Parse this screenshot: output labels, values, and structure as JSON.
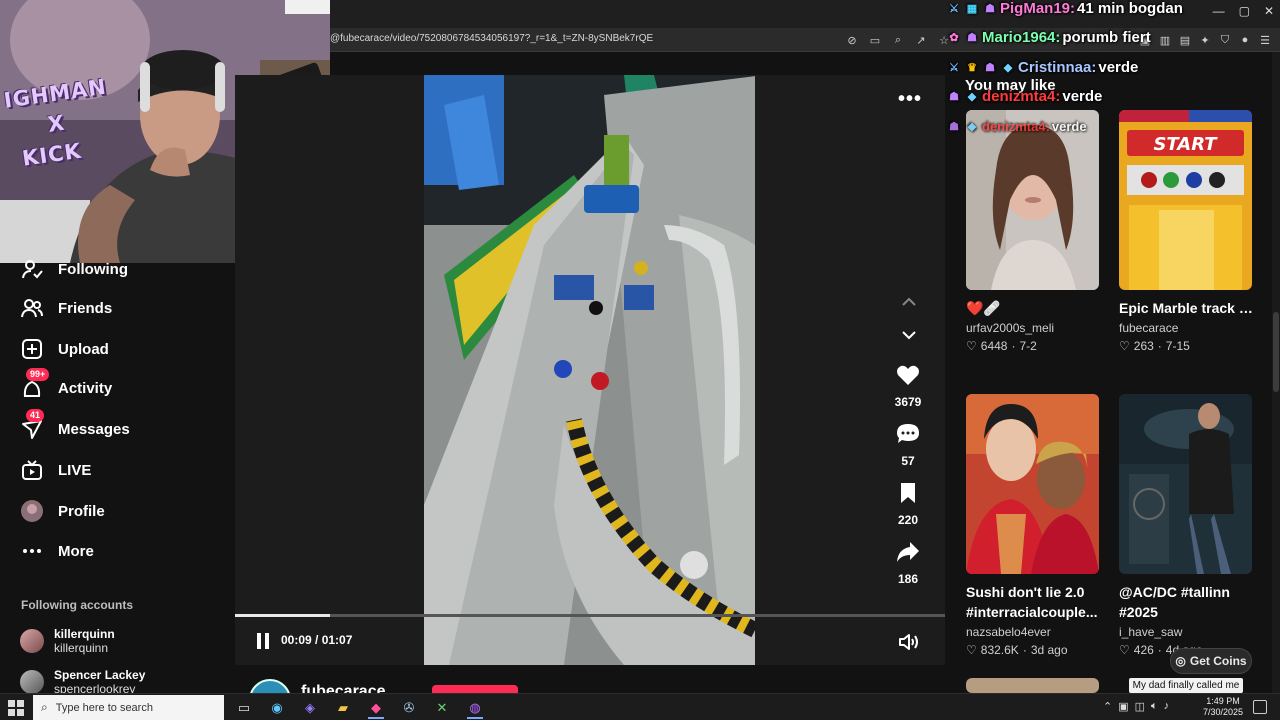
{
  "browser": {
    "url": "@fubecarace/video/7520806784534056197?_r=1&_t=ZN-8ySNBek7rQE",
    "window_controls": [
      "—",
      "▢",
      "✕"
    ]
  },
  "webcam": {
    "brand_line1": "IGHMAN",
    "brand_line2": "X",
    "brand_line3": "KICK"
  },
  "sidebar": {
    "items": [
      {
        "label": "Following",
        "icon": "following-icon"
      },
      {
        "label": "Friends",
        "icon": "friends-icon"
      },
      {
        "label": "Upload",
        "icon": "upload-icon"
      },
      {
        "label": "Activity",
        "icon": "activity-icon",
        "badge": "99+"
      },
      {
        "label": "Messages",
        "icon": "messages-icon",
        "badge": "41"
      },
      {
        "label": "LIVE",
        "icon": "live-icon"
      },
      {
        "label": "Profile",
        "icon": "profile-avatar"
      },
      {
        "label": "More",
        "icon": "more-icon"
      }
    ],
    "following_title": "Following accounts",
    "accounts": [
      {
        "name": "killerquinn",
        "handle": "killerquinn"
      },
      {
        "name": "Spencer Lackey",
        "handle": "spencerlookrey"
      }
    ]
  },
  "video": {
    "likes": "3679",
    "comments": "57",
    "saves": "220",
    "shares": "186",
    "time": "00:09 / 01:07",
    "progress": 0.134,
    "author": "fubecarace"
  },
  "recommended": {
    "title": "You may like",
    "cards": [
      {
        "title": "❤️🩹",
        "user": "urfav2000s_meli",
        "likes": "6448",
        "date": "7-2"
      },
      {
        "title": "Epic Marble track #MarbleRace...",
        "user": "fubecarace",
        "likes": "263",
        "date": "7-15"
      },
      {
        "title": "Sushi don't lie 2.0 #interracialcouple...",
        "user": "nazsabelo4ever",
        "likes": "832.6K",
        "date": "3d ago"
      },
      {
        "title": "@AC/DC #tallinn #2025",
        "user": "i_have_saw",
        "likes": "426",
        "date": "4d ago"
      }
    ],
    "get_coins": "Get Coins",
    "tooltip": "My dad finally called me"
  },
  "chat": [
    {
      "user": "PigMan19:",
      "msg": "41 min bogdan",
      "color": "#ff7ad9"
    },
    {
      "user": "Mario1964:",
      "msg": "porumb fiert",
      "color": "#7dffb0"
    },
    {
      "user": "Cristinnaa:",
      "msg": "verde",
      "color": "#a9c7ff"
    },
    {
      "user": "denizmta4:",
      "msg": "verde",
      "color": "#ff3b3b"
    },
    {
      "user": "denizmta4:",
      "msg": "verde",
      "color": "#ff3b3b"
    }
  ],
  "taskbar": {
    "search_placeholder": "Type here to search",
    "time": "1:49 PM",
    "date": "7/30/2025"
  },
  "colors": {
    "accent": "#fe2c55",
    "background": "#121212"
  }
}
